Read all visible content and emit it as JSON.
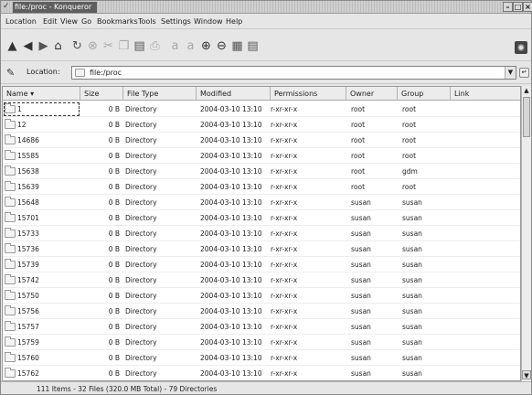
{
  "window": {
    "title": "file:/proc - Konqueror"
  },
  "menu": [
    "Location",
    "Edit",
    "View",
    "Go",
    "Bookmarks",
    "Tools",
    "Settings",
    "Window",
    "Help"
  ],
  "toolbar": {
    "icons": [
      "up-arrow-icon",
      "back-arrow-icon",
      "forward-arrow-icon",
      "home-icon",
      "reload-icon",
      "stop-icon",
      "cut-icon",
      "copy-icon",
      "paste-icon",
      "print-icon",
      "bigger-icon",
      "smaller-icon",
      "zoom-in-icon",
      "zoom-out-icon",
      "icon-view-icon",
      "detail-view-icon"
    ]
  },
  "location": {
    "label": "Location:",
    "value": "file:/proc"
  },
  "columns": [
    "Name",
    "Size",
    "File Type",
    "Modified",
    "Permissions",
    "Owner",
    "Group",
    "Link"
  ],
  "rows": [
    {
      "name": "1",
      "size": "0 B",
      "type": "Directory",
      "modified": "2004-03-10 13:10",
      "perm": "r-xr-xr-x",
      "owner": "root",
      "group": "root"
    },
    {
      "name": "12",
      "size": "0 B",
      "type": "Directory",
      "modified": "2004-03-10 13:10",
      "perm": "r-xr-xr-x",
      "owner": "root",
      "group": "root"
    },
    {
      "name": "14686",
      "size": "0 B",
      "type": "Directory",
      "modified": "2004-03-10 13:10",
      "perm": "r-xr-xr-x",
      "owner": "root",
      "group": "root"
    },
    {
      "name": "15585",
      "size": "0 B",
      "type": "Directory",
      "modified": "2004-03-10 13:10",
      "perm": "r-xr-xr-x",
      "owner": "root",
      "group": "root"
    },
    {
      "name": "15638",
      "size": "0 B",
      "type": "Directory",
      "modified": "2004-03-10 13:10",
      "perm": "r-xr-xr-x",
      "owner": "root",
      "group": "gdm"
    },
    {
      "name": "15639",
      "size": "0 B",
      "type": "Directory",
      "modified": "2004-03-10 13:10",
      "perm": "r-xr-xr-x",
      "owner": "root",
      "group": "root"
    },
    {
      "name": "15648",
      "size": "0 B",
      "type": "Directory",
      "modified": "2004-03-10 13:10",
      "perm": "r-xr-xr-x",
      "owner": "susan",
      "group": "susan"
    },
    {
      "name": "15701",
      "size": "0 B",
      "type": "Directory",
      "modified": "2004-03-10 13:10",
      "perm": "r-xr-xr-x",
      "owner": "susan",
      "group": "susan"
    },
    {
      "name": "15733",
      "size": "0 B",
      "type": "Directory",
      "modified": "2004-03-10 13:10",
      "perm": "r-xr-xr-x",
      "owner": "susan",
      "group": "susan"
    },
    {
      "name": "15736",
      "size": "0 B",
      "type": "Directory",
      "modified": "2004-03-10 13:10",
      "perm": "r-xr-xr-x",
      "owner": "susan",
      "group": "susan"
    },
    {
      "name": "15739",
      "size": "0 B",
      "type": "Directory",
      "modified": "2004-03-10 13:10",
      "perm": "r-xr-xr-x",
      "owner": "susan",
      "group": "susan"
    },
    {
      "name": "15742",
      "size": "0 B",
      "type": "Directory",
      "modified": "2004-03-10 13:10",
      "perm": "r-xr-xr-x",
      "owner": "susan",
      "group": "susan"
    },
    {
      "name": "15750",
      "size": "0 B",
      "type": "Directory",
      "modified": "2004-03-10 13:10",
      "perm": "r-xr-xr-x",
      "owner": "susan",
      "group": "susan"
    },
    {
      "name": "15756",
      "size": "0 B",
      "type": "Directory",
      "modified": "2004-03-10 13:10",
      "perm": "r-xr-xr-x",
      "owner": "susan",
      "group": "susan"
    },
    {
      "name": "15757",
      "size": "0 B",
      "type": "Directory",
      "modified": "2004-03-10 13:10",
      "perm": "r-xr-xr-x",
      "owner": "susan",
      "group": "susan"
    },
    {
      "name": "15759",
      "size": "0 B",
      "type": "Directory",
      "modified": "2004-03-10 13:10",
      "perm": "r-xr-xr-x",
      "owner": "susan",
      "group": "susan"
    },
    {
      "name": "15760",
      "size": "0 B",
      "type": "Directory",
      "modified": "2004-03-10 13:10",
      "perm": "r-xr-xr-x",
      "owner": "susan",
      "group": "susan"
    },
    {
      "name": "15762",
      "size": "0 B",
      "type": "Directory",
      "modified": "2004-03-10 13:10",
      "perm": "r-xr-xr-x",
      "owner": "susan",
      "group": "susan"
    }
  ],
  "status": "111 Items - 32 Files (320.0 MB Total) - 79 Directories"
}
